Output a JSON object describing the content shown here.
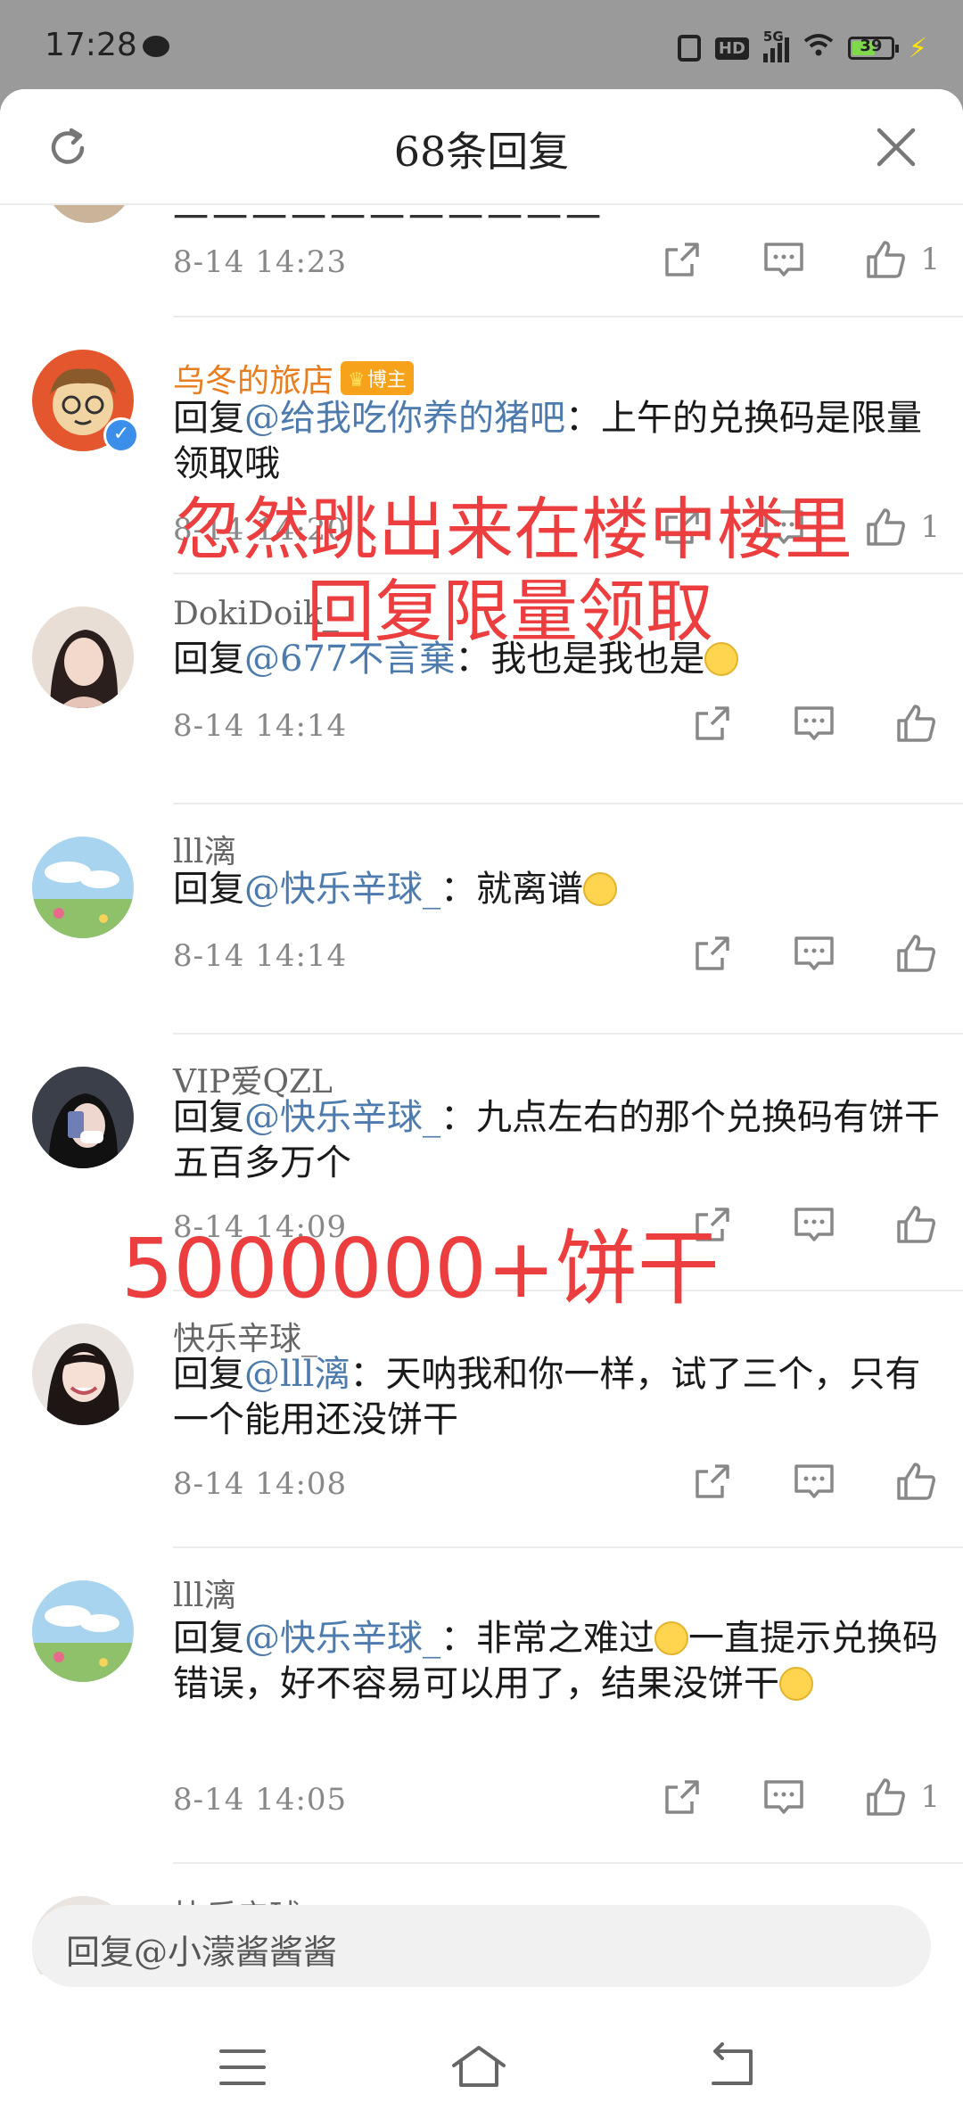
{
  "status_bar": {
    "time": "17:28",
    "network": "5G",
    "hd": "HD",
    "battery": "39",
    "battery_level": 0.39
  },
  "header": {
    "title": "68条回复"
  },
  "partial_top": {
    "text": "一一一一一一一一一一一"
  },
  "comments": [
    {
      "timestamp": "8-14  14:23",
      "like_count": "1"
    },
    {
      "username": "乌冬的旅店",
      "badge": "博主",
      "reply_prefix": "回复",
      "mention": "@给我吃你养的猪吧",
      "text": "：上午的兑换码是限量领取哦",
      "timestamp": "8-14  14:20",
      "like_count": "1",
      "verified": true
    },
    {
      "username": "DokiDoik_",
      "reply_prefix": "回复",
      "mention": "@677不言棄",
      "text": "：我也是我也是",
      "emoji": "crying-emoji",
      "timestamp": "8-14  14:14"
    },
    {
      "username": "lll漓",
      "reply_prefix": "回复",
      "mention": "@快乐辛球_",
      "text": "：就离谱",
      "emoji": "facepalm-emoji",
      "timestamp": "8-14  14:14"
    },
    {
      "username": "VIP爱QZL",
      "reply_prefix": "回复",
      "mention": "@快乐辛球_",
      "text": "：九点左右的那个兑换码有饼干五百多万个",
      "timestamp": "8-14  14:09"
    },
    {
      "username": "快乐辛球_",
      "reply_prefix": "回复",
      "mention": "@lll漓",
      "text": "：天呐我和你一样，试了三个，只有一个能用还没饼干",
      "timestamp": "8-14  14:08"
    },
    {
      "username": "lll漓",
      "reply_prefix": "回复",
      "mention": "@快乐辛球_",
      "text1": "：非常之难过",
      "text2": "一直提示兑换码错误，好不容易可以用了，结果没饼干",
      "emoji1": "sad-emoji",
      "emoji2": "crying-emoji",
      "timestamp": "8-14  14:05",
      "like_count": "1"
    },
    {
      "username": "快乐辛球_"
    }
  ],
  "overlays": {
    "line1": "忽然跳出来在楼中楼里",
    "line2": "回复限量领取",
    "line3": "5000000+饼干"
  },
  "input": {
    "placeholder": "回复@小濛酱酱酱"
  },
  "colors": {
    "mention": "#4e7bae",
    "overlay_red": "#ec3d3f",
    "blogger_orange": "#e77d1e"
  }
}
